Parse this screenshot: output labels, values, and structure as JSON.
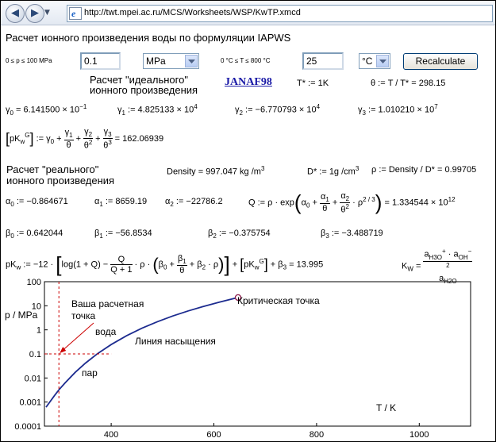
{
  "browser": {
    "back_glyph": "◀",
    "forward_glyph": "▶",
    "dropdown_glyph": "▼",
    "address_icon": "e",
    "url": "http://twt.mpei.ac.ru/MCS/Worksheets/WSP/KwTP.xmcd"
  },
  "header": {
    "title": "Расчет ионного произведения воды по формуляции IAPWS"
  },
  "controls": {
    "p_range": "0 ≤ p ≤ 100 MPa",
    "p_value": "0.1",
    "p_unit": "MPa",
    "t_range": "0 °C ≤ T ≤ 800 °C",
    "t_value": "25",
    "t_unit": "°C",
    "recalc_label": "Recalculate"
  },
  "ideal": {
    "heading_line1": "Расчет \"идеального\"",
    "heading_line2": "ионного произведения",
    "link": "JANAF98",
    "tstar": "T* := 1K",
    "theta": "θ := T / T* = 298.15",
    "g0": "6.141500 × 10",
    "g0_exp": "−1",
    "g1": "4.825133 × 10",
    "g1_exp": "4",
    "g2": "−6.770793 × 10",
    "g2_exp": "4",
    "g3": "1.010210 × 10",
    "g3_exp": "7",
    "pkw_result": "= 162.06939"
  },
  "real": {
    "heading_line1": "Расчет \"реального\"",
    "heading_line2": "ионного произведения",
    "density": "Density = 997.047 kg /m",
    "dstar": "D* := 1g /cm",
    "rho": "ρ := Density / D* = 0.99705",
    "a0": "−0.864671",
    "a1": "8659.19",
    "a2": "−22786.2",
    "q_result": "= 1.334544 × 10",
    "q_exp": "12",
    "b0": "0.642044",
    "b1": "−56.8534",
    "b2": "−0.375754",
    "b3": "−3.488719",
    "pkw_result": "= 13.995"
  },
  "chart_labels": {
    "ylabel": "p / MPa",
    "xlabel": "T / K",
    "point_label_line1": "Ваша расчетная",
    "point_label_line2": "точка",
    "water": "вода",
    "steam": "пар",
    "saturation": "Линия насыщения",
    "critical": "Критическая точка"
  },
  "chart_data": {
    "type": "line",
    "xlim": [
      270,
      1100
    ],
    "ylim": [
      0.0001,
      100
    ],
    "yscale": "log",
    "xticks": [
      400,
      600,
      800,
      1000
    ],
    "yticks": [
      0.0001,
      0.001,
      0.01,
      0.1,
      1,
      10,
      100
    ],
    "ytick_labels": [
      "0.0001",
      "0.001",
      "0.01",
      "0.1",
      "1",
      "10",
      "100"
    ],
    "grid": false,
    "series": [
      {
        "x": [
          273.16,
          290,
          298.15,
          310,
          330,
          350,
          373.15,
          400,
          430,
          460,
          490,
          520,
          550,
          580,
          610,
          640,
          647.1
        ],
        "y": [
          0.000612,
          0.0019,
          0.0032,
          0.0062,
          0.0172,
          0.0417,
          0.1013,
          0.2458,
          0.5708,
          1.174,
          2.183,
          3.766,
          6.112,
          9.442,
          14.04,
          20.27,
          22.06
        ]
      }
    ],
    "current_point": {
      "x": 298.15,
      "y": 0.1
    },
    "critical_point": {
      "x": 647.1,
      "y": 22.06
    },
    "colors": {
      "curve": "#1c2b8f",
      "marker": "#cc0000",
      "critical": "#8b1a4a"
    }
  }
}
